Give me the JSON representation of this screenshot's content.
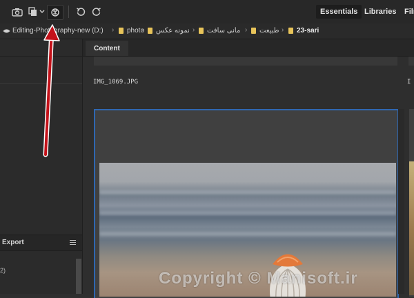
{
  "toolbar": {
    "icons": [
      "camera-get-photos-icon",
      "copy-stack-icon",
      "chevron-down-icon",
      "camera-raw-refine-icon",
      "rotate-left-icon",
      "rotate-right-icon"
    ],
    "workspaces": [
      {
        "label": "Essentials",
        "active": true
      },
      {
        "label": "Libraries",
        "active": false
      },
      {
        "label": "Film",
        "active": false
      }
    ]
  },
  "breadcrumb": {
    "items": [
      {
        "label": "Editing-Photography-new (D:)",
        "folder": false
      },
      {
        "label": "photo",
        "folder": true
      },
      {
        "label": "نمونه عکس",
        "folder": true
      },
      {
        "label": "مانی سافت",
        "folder": true
      },
      {
        "label": "طبیعت",
        "folder": true
      },
      {
        "label": "23-sari",
        "folder": true
      }
    ]
  },
  "left_panel": {
    "export_title": "Export",
    "export_count": "2)"
  },
  "content": {
    "tab_label": "Content",
    "file_name": "IMG_1069.JPG",
    "file_name_next": "I"
  },
  "annotation": {
    "arrow_color": "#c4121a"
  },
  "colors": {
    "accent_selection": "#2f67b1",
    "folder": "#e8c45a"
  },
  "watermark": "Copyright © Manisoft.ir"
}
